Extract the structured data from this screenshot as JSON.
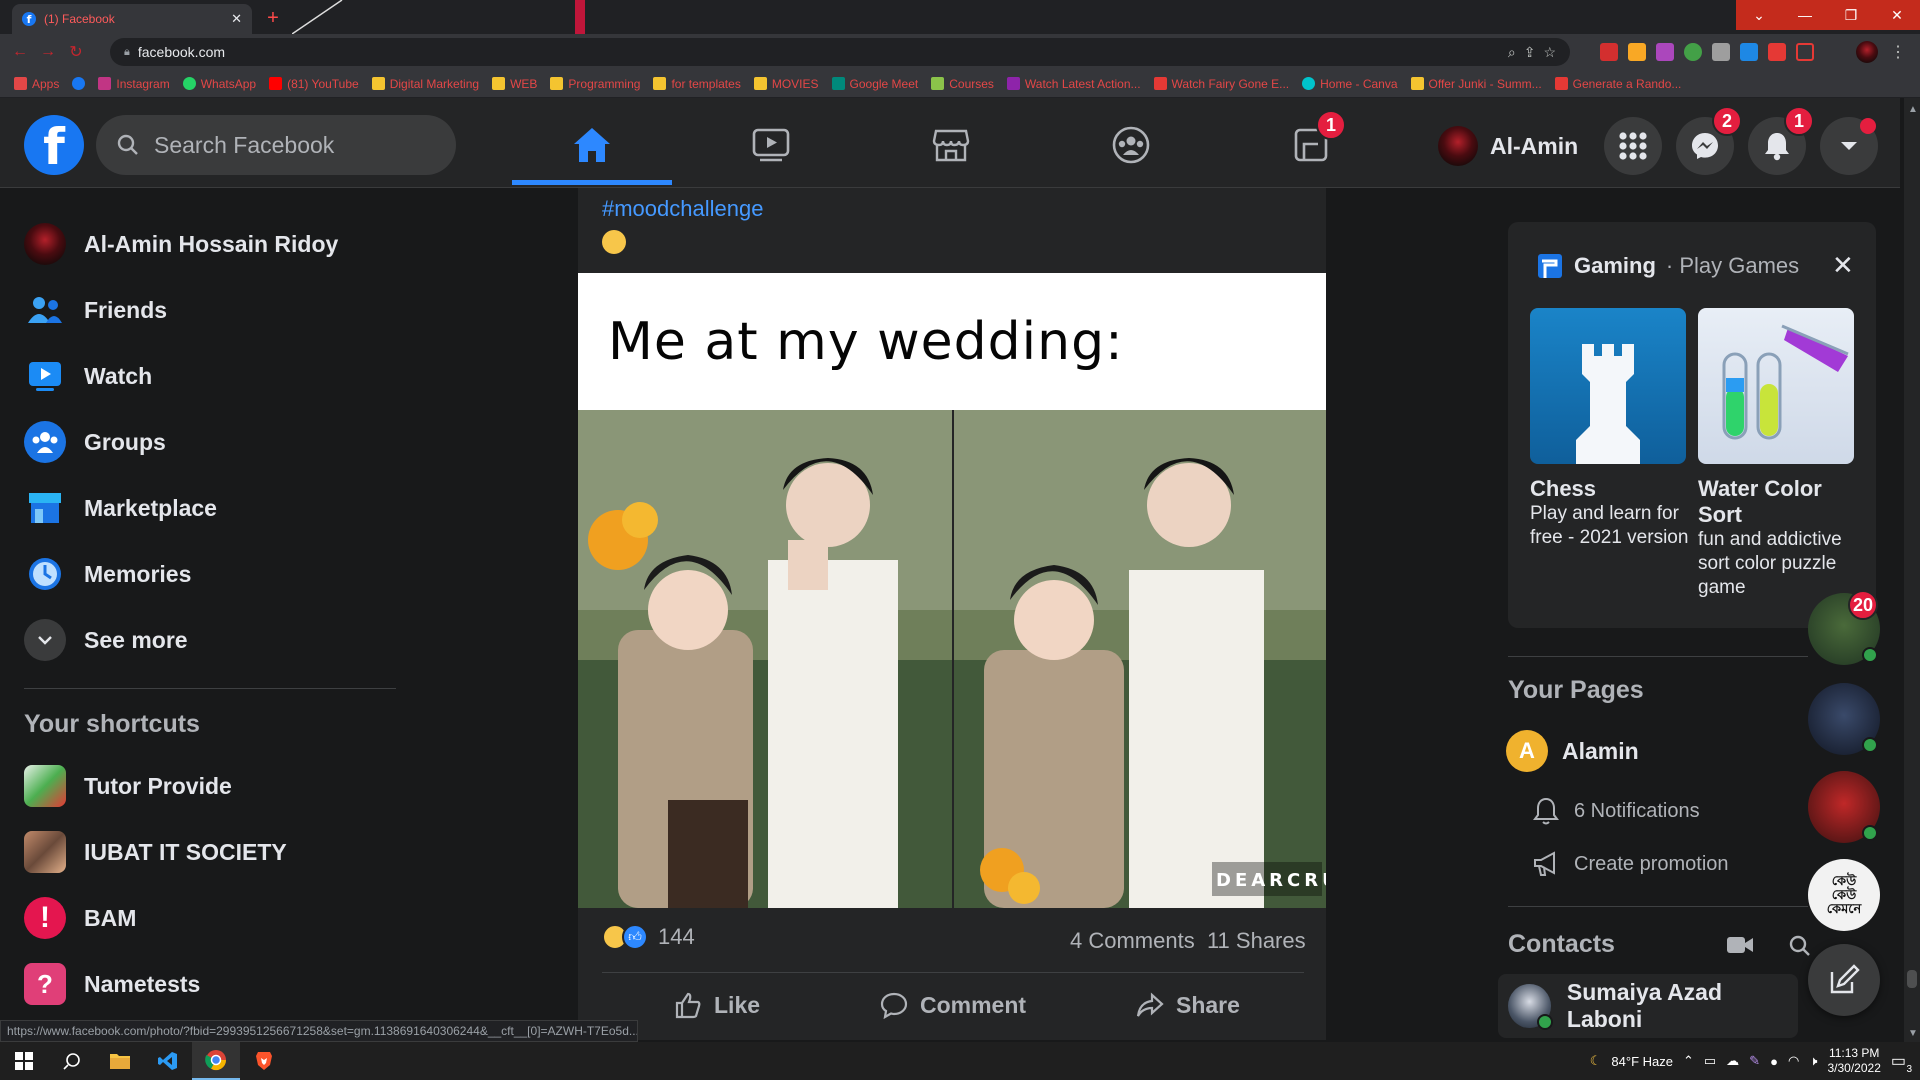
{
  "browser": {
    "tab_title": "(1) Facebook",
    "url": "facebook.com",
    "bookmarks": [
      {
        "label": "Apps",
        "color": "#e34747"
      },
      {
        "label": "",
        "color": "#1877f2"
      },
      {
        "label": "Instagram",
        "color": "#c13584"
      },
      {
        "label": "WhatsApp",
        "color": "#25d366"
      },
      {
        "label": "(81) YouTube",
        "color": "#ff0000"
      },
      {
        "label": "Digital Marketing",
        "color": "#f4c430"
      },
      {
        "label": "WEB",
        "color": "#f4c430"
      },
      {
        "label": "Programming",
        "color": "#f4c430"
      },
      {
        "label": "for templates",
        "color": "#f4c430"
      },
      {
        "label": "MOVIES",
        "color": "#f4c430"
      },
      {
        "label": "Google Meet",
        "color": "#00897b"
      },
      {
        "label": "Courses",
        "color": "#8bc34a"
      },
      {
        "label": "Watch Latest Action...",
        "color": "#8e24aa"
      },
      {
        "label": "Watch Fairy Gone E...",
        "color": "#e53935"
      },
      {
        "label": "Home - Canva",
        "color": "#00c4cc"
      },
      {
        "label": "Offer Junki - Summ...",
        "color": "#f4c430"
      },
      {
        "label": "Generate a Rando...",
        "color": "#e53935"
      }
    ],
    "status_url": "https://www.facebook.com/photo/?fbid=2993951256671258&set=gm.1138691640306244&__cft__[0]=AZWH-T7Eo5d..."
  },
  "header": {
    "search_placeholder": "Search Facebook",
    "gaming_badge": "1",
    "profile_name": "Al-Amin",
    "messenger_badge": "2",
    "notifications_badge": "1"
  },
  "left_nav": {
    "items": [
      {
        "label": "Al-Amin Hossain Ridoy"
      },
      {
        "label": "Friends"
      },
      {
        "label": "Watch"
      },
      {
        "label": "Groups"
      },
      {
        "label": "Marketplace"
      },
      {
        "label": "Memories"
      },
      {
        "label": "See more"
      }
    ],
    "shortcuts_title": "Your shortcuts",
    "shortcuts": [
      {
        "label": "Tutor Provide"
      },
      {
        "label": "IUBAT IT SOCIETY"
      },
      {
        "label": "BAM"
      },
      {
        "label": "Nametests"
      }
    ]
  },
  "post": {
    "hashtag": "#moodchallenge",
    "meme_caption": "Me at my wedding:",
    "watermark": "DEARCRUSH",
    "reaction_count": "144",
    "comments": "4 Comments",
    "shares": "11 Shares",
    "actions": {
      "like": "Like",
      "comment": "Comment",
      "share": "Share"
    }
  },
  "right": {
    "gaming_title": "Gaming",
    "gaming_sub": "· Play Games",
    "games": [
      {
        "name": "Chess",
        "desc": "Play and learn for free - 2021 version"
      },
      {
        "name": "Water Color Sort",
        "desc": "fun and addictive sort color puzzle game"
      }
    ],
    "pages_title": "Your Pages",
    "page_name": "Alamin",
    "page_initial": "A",
    "page_notifications": "6 Notifications",
    "create_promotion": "Create promotion",
    "contacts_title": "Contacts",
    "contact_name": "Sumaiya Azad Laboni",
    "chat_badge": "20",
    "chat_head_text": "কেউ কেউ কেমনে"
  },
  "taskbar": {
    "weather": "84°F  Haze",
    "time": "11:13 PM",
    "date": "3/30/2022",
    "notif_count": "3"
  },
  "colors": {
    "fb_blue": "#1877f2",
    "accent": "#2d88ff",
    "badge": "#e41e3f",
    "bg": "#18191a",
    "surface": "#242526"
  }
}
